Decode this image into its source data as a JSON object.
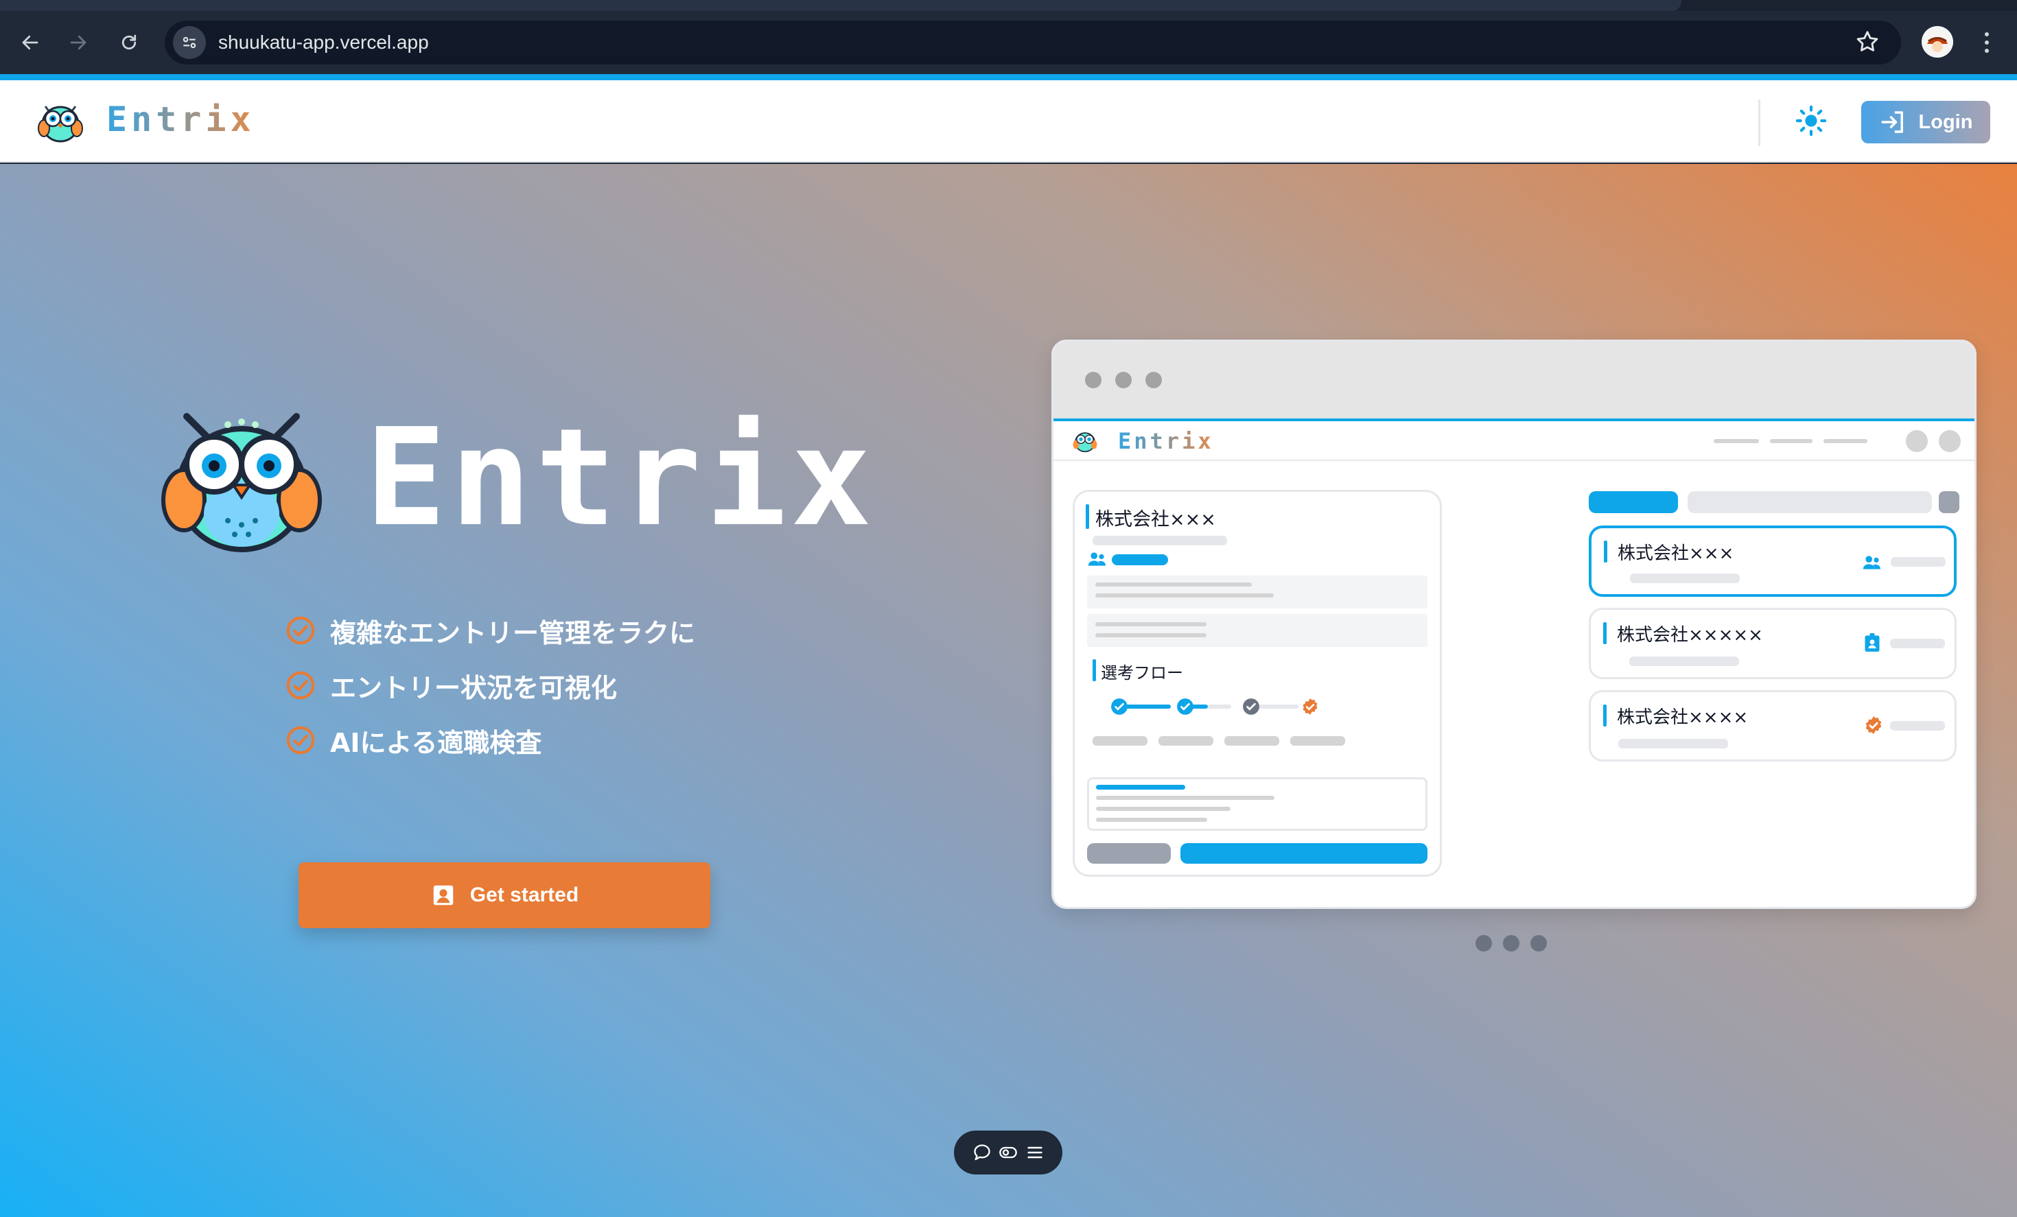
{
  "browser": {
    "url": "shuukatu-app.vercel.app"
  },
  "header": {
    "brand": "Entrix",
    "login_label": "Login"
  },
  "hero": {
    "title": "Entrix",
    "features": [
      "複雑なエントリー管理をラクに",
      "エントリー状況を可視化",
      "AIによる適職検査"
    ],
    "cta_label": "Get started"
  },
  "mock": {
    "brand": "Entrix",
    "detail_company": "株式会社×××",
    "flow_label": "選考フロー",
    "list": [
      {
        "company": "株式会社×××",
        "icon": "people-icon"
      },
      {
        "company": "株式会社×××××",
        "icon": "id-badge-icon"
      },
      {
        "company": "株式会社××××",
        "icon": "verified-icon"
      }
    ]
  },
  "colors": {
    "accent_blue": "#0ea5e9",
    "accent_orange": "#e87b35"
  }
}
